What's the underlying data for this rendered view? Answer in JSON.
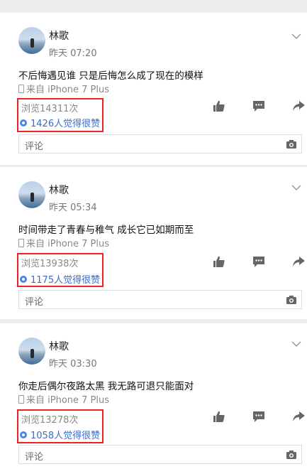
{
  "posts": [
    {
      "author": "林歌",
      "time": "昨天 07:20",
      "content": "不后悔遇见谁 只是后悔怎么成了现在的模样",
      "source": "来自 iPhone 7 Plus",
      "views": "浏览14311次",
      "likes": "1426人觉得很赞",
      "comment_placeholder": "评论"
    },
    {
      "author": "林歌",
      "time": "昨天 05:34",
      "content": "时间带走了青春与稚气 成长它已如期而至",
      "source": "来自 iPhone 7 Plus",
      "views": "浏览13938次",
      "likes": "1175人觉得很赞",
      "comment_placeholder": "评论"
    },
    {
      "author": "林歌",
      "time": "昨天 03:30",
      "content": "你走后偶尔夜路太黑 我无路可退只能面对",
      "source": "来自 iPhone 7 Plus",
      "views": "浏览13278次",
      "likes": "1058人觉得很赞",
      "comment_placeholder": "评论"
    }
  ],
  "icons": {
    "like": "thumbs-up-icon",
    "comment": "comment-icon",
    "share": "share-icon",
    "camera": "camera-icon",
    "more": "chevron-down-icon",
    "device": "phone-icon"
  },
  "colors": {
    "highlight_box": "#ee2222",
    "like_text": "#3a6cc8",
    "meta_text": "#888888"
  }
}
